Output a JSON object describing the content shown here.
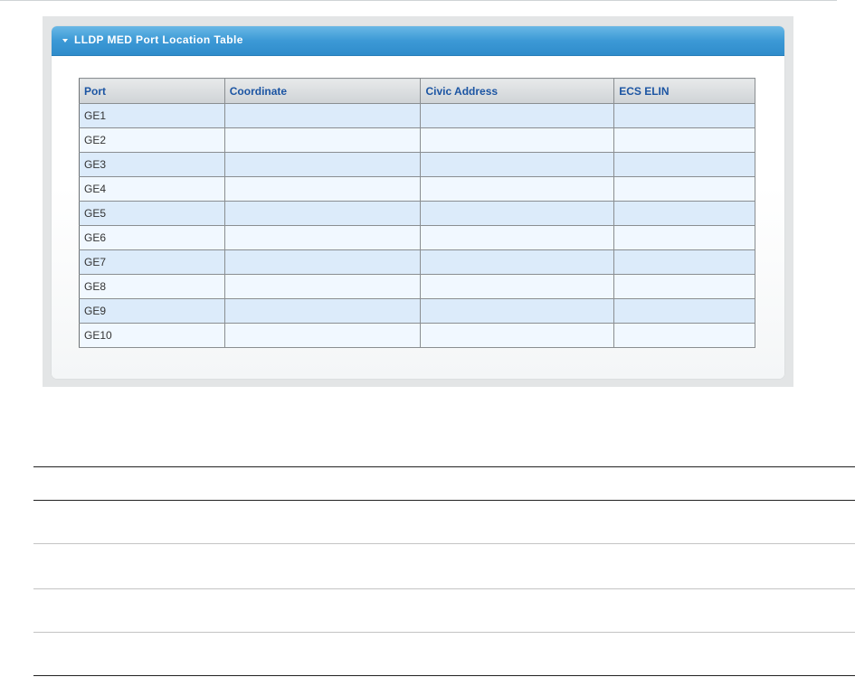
{
  "panel": {
    "title": "LLDP MED Port Location Table",
    "columns": [
      "Port",
      "Coordinate",
      "Civic Address",
      "ECS ELIN"
    ],
    "rows": [
      {
        "port": "GE1",
        "coordinate": "",
        "civic": "",
        "ecs": ""
      },
      {
        "port": "GE2",
        "coordinate": "",
        "civic": "",
        "ecs": ""
      },
      {
        "port": "GE3",
        "coordinate": "",
        "civic": "",
        "ecs": ""
      },
      {
        "port": "GE4",
        "coordinate": "",
        "civic": "",
        "ecs": ""
      },
      {
        "port": "GE5",
        "coordinate": "",
        "civic": "",
        "ecs": ""
      },
      {
        "port": "GE6",
        "coordinate": "",
        "civic": "",
        "ecs": ""
      },
      {
        "port": "GE7",
        "coordinate": "",
        "civic": "",
        "ecs": ""
      },
      {
        "port": "GE8",
        "coordinate": "",
        "civic": "",
        "ecs": ""
      },
      {
        "port": "GE9",
        "coordinate": "",
        "civic": "",
        "ecs": ""
      },
      {
        "port": "GE10",
        "coordinate": "",
        "civic": "",
        "ecs": ""
      }
    ]
  },
  "colors": {
    "header_blue": "#3c99d6",
    "column_header_text": "#1c55a3",
    "row_odd": "#dcebfa",
    "row_even": "#f1f8ff"
  }
}
